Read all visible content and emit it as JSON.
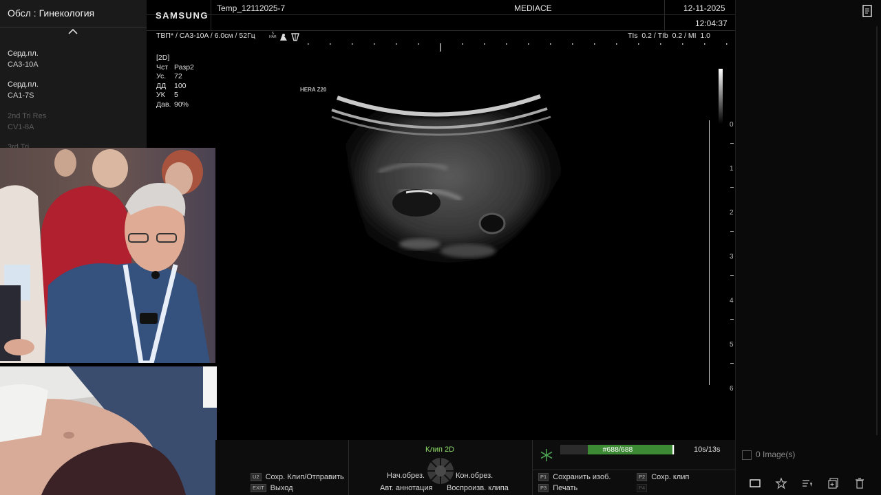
{
  "presets": {
    "header": "Обсл : Гинекология",
    "items": [
      {
        "name": "Серд.пл.",
        "probe": "CA3-10A",
        "dim": false
      },
      {
        "name": "Серд.пл.",
        "probe": "CA1-7S",
        "dim": false
      },
      {
        "name": "2nd Tri Res",
        "probe": "CV1-8A",
        "dim": true
      },
      {
        "name": "3rd Tri",
        "probe": "",
        "dim": true
      }
    ]
  },
  "header": {
    "brand": "SAMSUNG",
    "patient_id": "Temp_12112025-7",
    "institution": "MEDIACE",
    "date": "12-11-2025",
    "time": "12:04:37"
  },
  "imaging": {
    "probe_line": "ТВП* / CA3-10A / 6.0см / 52Гц",
    "har_label": "S\nHAR",
    "thermal_line": "TIs  0.2 / TIb  0.2 / MI  1.0",
    "mode": "[2D]",
    "params": [
      {
        "key": "Чст",
        "value": "Разр2"
      },
      {
        "key": "Ус.",
        "value": "72"
      },
      {
        "key": "ДД",
        "value": "100"
      },
      {
        "key": "УК",
        "value": "5"
      },
      {
        "key": "Дав.",
        "value": "90%"
      }
    ],
    "device_label": "HERA Z20",
    "depth_labels": [
      "0",
      "1",
      "2",
      "3",
      "4",
      "5",
      "6"
    ]
  },
  "bottom": {
    "save_clip_send": "Сохр. Клип/Отправить",
    "save_clip_send_key": "U2",
    "exit": "Выход",
    "exit_key": "EXIT",
    "clip_mode": "Клип 2D",
    "trim_start": "Нач.обрез.",
    "trim_end": "Кон.обрез.",
    "auto_annotation": "Авт. аннотация",
    "play_clip": "Воспроизв. клипа",
    "frame_counter": "#688/688",
    "frame_progress": 1.0,
    "clip_time": "10s/13s",
    "save_image": "Сохранить изоб.",
    "save_image_key": "P1",
    "print": "Печать",
    "print_key": "P3",
    "save_clip": "Сохр. клип",
    "save_clip_key": "P2",
    "p4_key": "P4"
  },
  "sidebar": {
    "image_count": "0 Image(s)"
  },
  "colors": {
    "clip_green": "#8fdc6a",
    "progress_green": "#3d8a34",
    "freeze_icon": "#4aa050"
  }
}
